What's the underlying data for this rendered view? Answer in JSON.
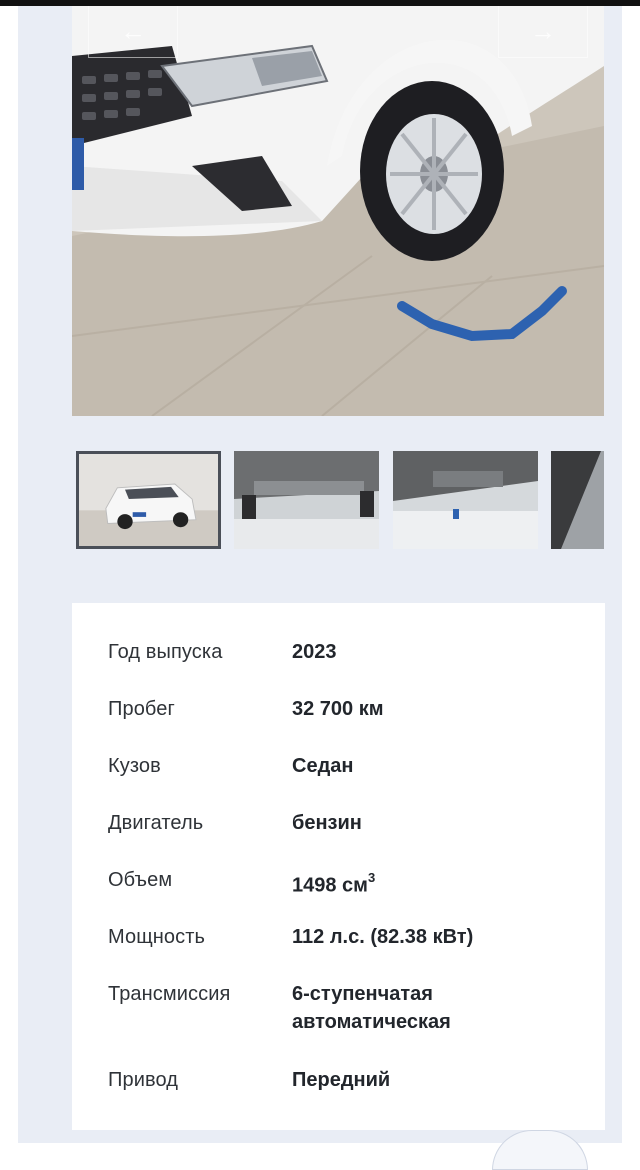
{
  "gallery": {
    "prev_icon": "arrow-left-icon",
    "next_icon": "arrow-right-icon",
    "thumbnails": [
      {
        "name": "thumbnail-front-view",
        "active": true
      },
      {
        "name": "thumbnail-underbody-1",
        "active": false
      },
      {
        "name": "thumbnail-underbody-2",
        "active": false
      },
      {
        "name": "thumbnail-partial",
        "active": false
      }
    ]
  },
  "specs": {
    "year": {
      "label": "Год выпуска",
      "value": "2023"
    },
    "mileage": {
      "label": "Пробег",
      "value": "32 700 км"
    },
    "body": {
      "label": "Кузов",
      "value": "Седан"
    },
    "engine": {
      "label": "Двигатель",
      "value": "бензин"
    },
    "volume": {
      "label": "Объем",
      "value": "1498 см",
      "unit_sup": "3"
    },
    "power": {
      "label": "Мощность",
      "value": "112 л.с. (82.38 кВт)"
    },
    "transmission": {
      "label": "Трансмиссия",
      "value_line1": "6-ступенчатая",
      "value_line2": "автоматическая"
    },
    "drive": {
      "label": "Привод",
      "value": "Передний"
    }
  },
  "colors": {
    "panel_bg": "#e9edf5",
    "card_bg": "#ffffff",
    "text": "#2b2f36"
  }
}
